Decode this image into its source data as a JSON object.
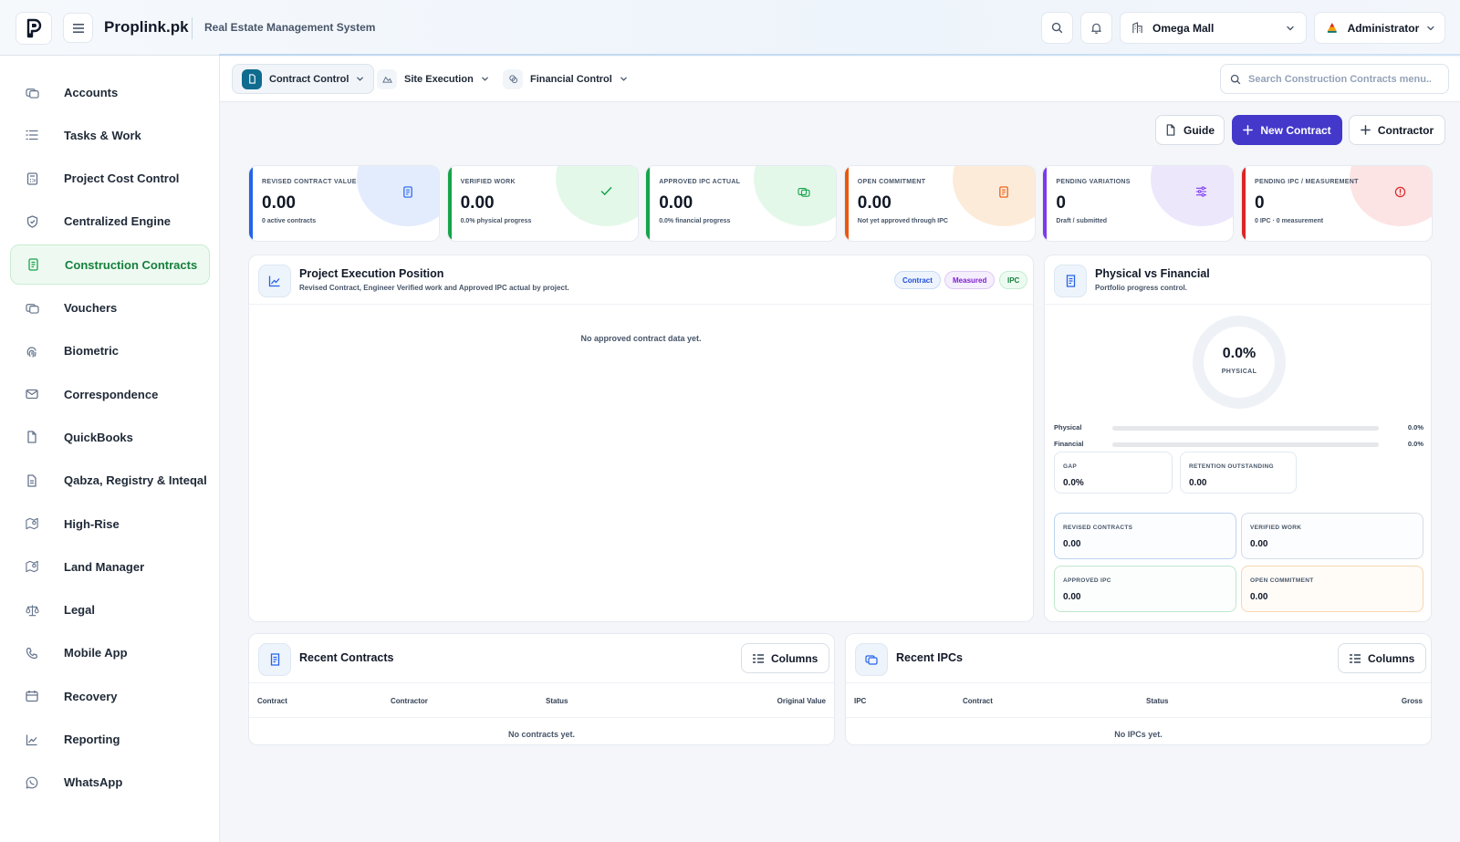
{
  "header": {
    "brand": "Proplink.pk",
    "subtitle": "Real Estate Management System",
    "site_selector": "Omega Mall",
    "user": "Administrator"
  },
  "sidebar": {
    "items": [
      {
        "label": "Accounts",
        "icon": "accounts-icon"
      },
      {
        "label": "Tasks & Work",
        "icon": "list-icon"
      },
      {
        "label": "Project Cost Control",
        "icon": "calculator-icon"
      },
      {
        "label": "Centralized Engine",
        "icon": "shield-icon"
      },
      {
        "label": "Construction Contracts",
        "icon": "contract-icon",
        "active": true
      },
      {
        "label": "Vouchers",
        "icon": "vouchers-icon"
      },
      {
        "label": "Biometric",
        "icon": "fingerprint-icon"
      },
      {
        "label": "Correspondence",
        "icon": "mail-icon"
      },
      {
        "label": "QuickBooks",
        "icon": "file-icon"
      },
      {
        "label": "Qabza, Registry & Inteqal",
        "icon": "document-icon"
      },
      {
        "label": "High-Rise",
        "icon": "map-icon"
      },
      {
        "label": "Land Manager",
        "icon": "map-icon"
      },
      {
        "label": "Legal",
        "icon": "scale-icon"
      },
      {
        "label": "Mobile App",
        "icon": "phone-icon"
      },
      {
        "label": "Recovery",
        "icon": "calendar-icon"
      },
      {
        "label": "Reporting",
        "icon": "chart-icon"
      },
      {
        "label": "WhatsApp",
        "icon": "whatsapp-icon"
      }
    ]
  },
  "subnav": {
    "tabs": [
      {
        "label": "Contract Control",
        "active": true
      },
      {
        "label": "Site Execution"
      },
      {
        "label": "Financial Control"
      }
    ],
    "search_placeholder": "Search Construction Contracts menu..."
  },
  "actions": {
    "guide": "Guide",
    "new_contract": "New Contract",
    "contractor": "Contractor"
  },
  "kpis": [
    {
      "label": "REVISED CONTRACT VALUE",
      "value": "0.00",
      "sub": "0 active contracts",
      "color": "#2563eb",
      "tint": "#e3ecfd"
    },
    {
      "label": "VERIFIED WORK",
      "value": "0.00",
      "sub": "0.0% physical progress",
      "color": "#16a34a",
      "tint": "#e4f8ea"
    },
    {
      "label": "APPROVED IPC ACTUAL",
      "value": "0.00",
      "sub": "0.0% financial progress",
      "color": "#16a34a",
      "tint": "#e4f8ea"
    },
    {
      "label": "OPEN COMMITMENT",
      "value": "0.00",
      "sub": "Not yet approved through IPC",
      "color": "#ea580c",
      "tint": "#fdebd9"
    },
    {
      "label": "PENDING VARIATIONS",
      "value": "0",
      "sub": "Draft / submitted",
      "color": "#7c3aed",
      "tint": "#ede7fc"
    },
    {
      "label": "PENDING IPC / MEASUREMENT",
      "value": "0",
      "sub": "0 IPC · 0 measurement",
      "color": "#dc2626",
      "tint": "#fde4e4"
    }
  ],
  "execution": {
    "title": "Project Execution Position",
    "subtitle": "Revised Contract, Engineer Verified work and Approved IPC actual by project.",
    "chips": [
      "Contract",
      "Measured",
      "IPC"
    ],
    "empty": "No approved contract data yet."
  },
  "physical_financial": {
    "title": "Physical vs Financial",
    "subtitle": "Portfolio progress control.",
    "donut_value": "0.0%",
    "donut_label": "PHYSICAL",
    "donut_fraction": 0.0,
    "bars": [
      {
        "label": "Physical",
        "value": "0.0%",
        "fraction": 0.0
      },
      {
        "label": "Financial",
        "value": "0.0%",
        "fraction": 0.0
      }
    ],
    "gap_label": "GAP",
    "gap_value": "0.0%",
    "retention_label": "RETENTION OUTSTANDING",
    "retention_value": "0.00",
    "tiles": [
      {
        "label": "REVISED CONTRACTS",
        "value": "0.00",
        "color": "#bcd4f2"
      },
      {
        "label": "VERIFIED WORK",
        "value": "0.00",
        "color": "#d6dde7"
      },
      {
        "label": "APPROVED IPC",
        "value": "0.00",
        "color": "#bfe8cb"
      },
      {
        "label": "OPEN COMMITMENT",
        "value": "0.00",
        "color": "#f6d6b1"
      }
    ]
  },
  "recent_contracts": {
    "title": "Recent Contracts",
    "columns_btn": "Columns",
    "headers": [
      "Contract",
      "Contractor",
      "Status",
      "Original Value"
    ],
    "empty": "No contracts yet."
  },
  "recent_ipcs": {
    "title": "Recent IPCs",
    "columns_btn": "Columns",
    "headers": [
      "IPC",
      "Contract",
      "Status",
      "Gross"
    ],
    "empty": "No IPCs yet."
  }
}
